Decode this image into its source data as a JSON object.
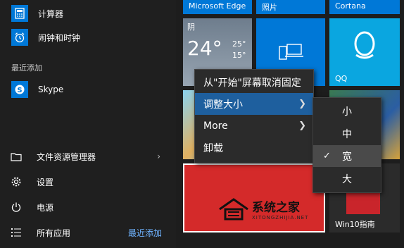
{
  "left_panel": {
    "top_apps": [
      {
        "label": "计算器",
        "icon": "calculator-icon"
      },
      {
        "label": "闹钟和时钟",
        "icon": "alarm-clock-icon"
      }
    ],
    "recent_header": "最近添加",
    "recent_apps": [
      {
        "label": "Skype",
        "icon": "skype-icon"
      }
    ],
    "bottom_items": [
      {
        "label": "文件资源管理器",
        "icon": "folder-icon",
        "chevron": "›"
      },
      {
        "label": "设置",
        "icon": "gear-icon"
      },
      {
        "label": "电源",
        "icon": "power-icon"
      },
      {
        "label": "所有应用",
        "icon": "list-icon"
      }
    ],
    "recent_link": "最近添加"
  },
  "tiles": {
    "edge": "Microsoft Edge",
    "photos": "照片",
    "cortana": "Cortana",
    "weather": {
      "condition": "阴",
      "temp": "24°",
      "high": "25°",
      "low": "15°"
    },
    "qq": "QQ",
    "win10guide": "Win10指南"
  },
  "context_menu": {
    "items": [
      "从\"开始\"屏幕取消固定",
      "调整大小",
      "More",
      "卸载"
    ],
    "selected": "调整大小"
  },
  "resize_submenu": {
    "items": [
      "小",
      "中",
      "宽",
      "大"
    ],
    "checked": "宽"
  },
  "watermark": {
    "title": "系统之家",
    "sub": "XITONGZHIJIA.NET"
  },
  "colors": {
    "accent": "#0078d7",
    "menu_selected": "#1e5f9e",
    "red_tile": "#d42a2a",
    "link": "#6fb3ff"
  }
}
